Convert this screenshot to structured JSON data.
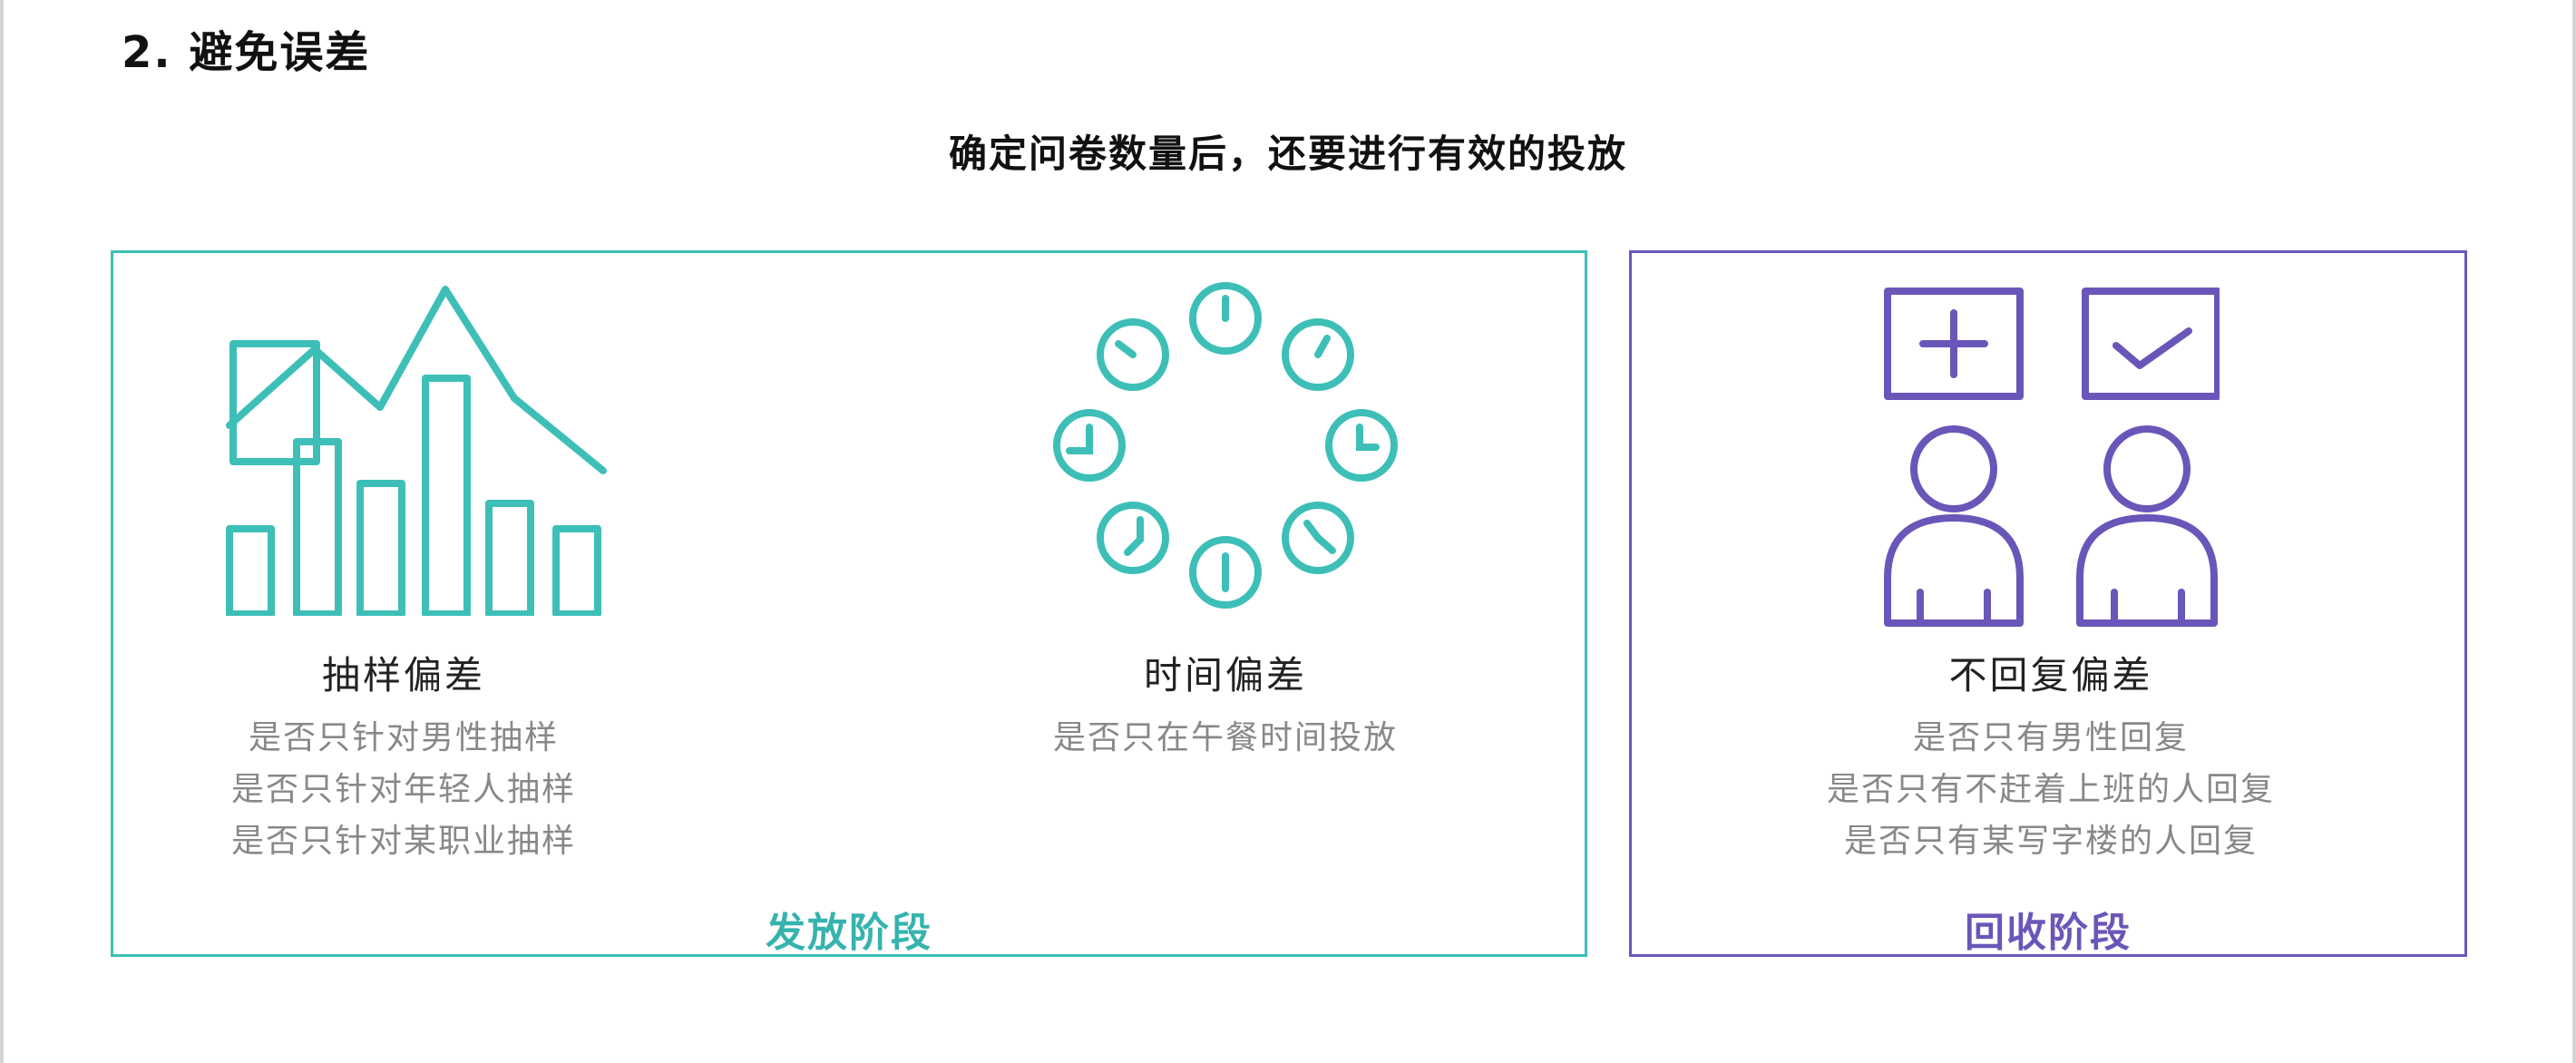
{
  "section_heading": "2. 避免误差",
  "subtitle": "确定问卷数量后，还要进行有效的投放",
  "colors": {
    "teal": "#3dbfb8",
    "purple": "#6a56b9"
  },
  "panels": [
    {
      "stage": "发放阶段",
      "items": [
        {
          "icon": "bar-chart-trend-icon",
          "title": "抽样偏差",
          "desc": [
            "是否只针对男性抽样",
            "是否只针对年轻人抽样",
            "是否只针对某职业抽样"
          ]
        },
        {
          "icon": "clock-ring-icon",
          "title": "时间偏差",
          "desc": [
            "是否只在午餐时间投放"
          ]
        }
      ]
    },
    {
      "stage": "回收阶段",
      "items": [
        {
          "icon": "users-response-icon",
          "title": "不回复偏差",
          "desc": [
            "是否只有男性回复",
            "是否只有不赶着上班的人回复",
            "是否只有某写字楼的人回复"
          ]
        }
      ]
    }
  ]
}
